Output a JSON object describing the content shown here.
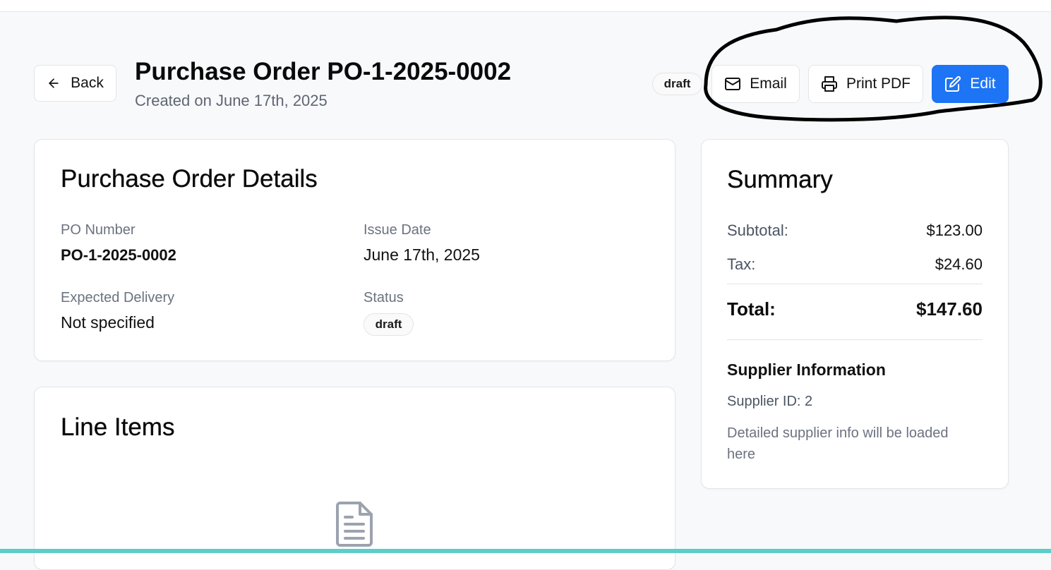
{
  "header": {
    "back_label": "Back",
    "title": "Purchase Order PO-1-2025-0002",
    "subtitle": "Created on June 17th, 2025",
    "status_badge": "draft",
    "actions": {
      "email_label": "Email",
      "print_label": "Print PDF",
      "edit_label": "Edit"
    }
  },
  "details": {
    "title": "Purchase Order Details",
    "po_number_label": "PO Number",
    "po_number": "PO-1-2025-0002",
    "issue_date_label": "Issue Date",
    "issue_date": "June 17th, 2025",
    "expected_delivery_label": "Expected Delivery",
    "expected_delivery": "Not specified",
    "status_label": "Status",
    "status": "draft"
  },
  "line_items": {
    "title": "Line Items"
  },
  "summary": {
    "title": "Summary",
    "subtotal_label": "Subtotal:",
    "subtotal": "$123.00",
    "tax_label": "Tax:",
    "tax": "$24.60",
    "total_label": "Total:",
    "total": "$147.60",
    "supplier": {
      "title": "Supplier Information",
      "id_text": "Supplier ID: 2",
      "note": "Detailed supplier info will be loaded here"
    }
  },
  "colors": {
    "accent": "#1d74f5",
    "page_background": "#f8f9fb",
    "bottom_strip": "#5ccdc8",
    "annotation_ink": "#000000"
  },
  "icons": {
    "back": "arrow-left-icon",
    "email": "mail-icon",
    "print": "printer-icon",
    "edit": "edit-icon",
    "empty_state": "document-icon"
  }
}
